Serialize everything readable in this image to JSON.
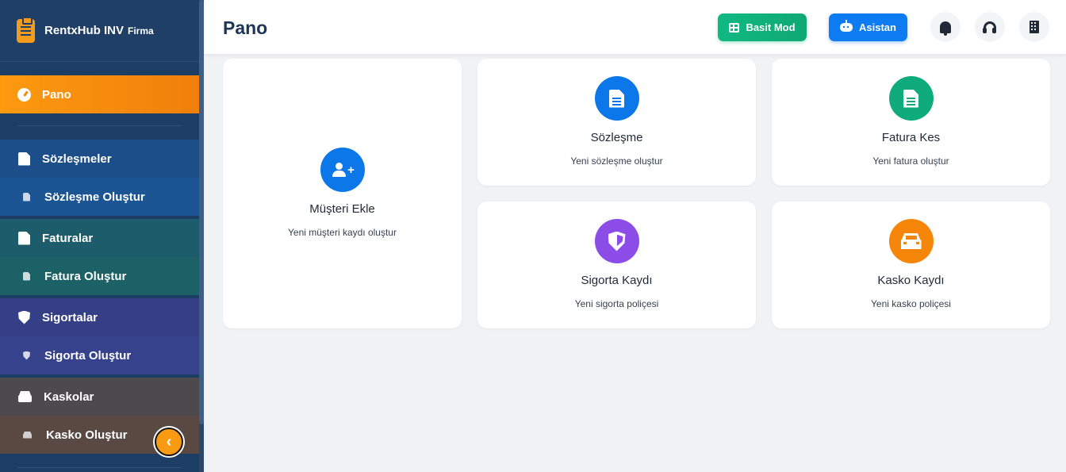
{
  "brand": {
    "name": "RentxHub INV",
    "sub": "Firma"
  },
  "sidebar": {
    "active": {
      "label": "Pano"
    },
    "groups": [
      {
        "label": "Sözleşmeler",
        "sub": "Sözleşme Oluştur"
      },
      {
        "label": "Faturalar",
        "sub": "Fatura Oluştur"
      },
      {
        "label": "Sigortalar",
        "sub": "Sigorta Oluştur"
      },
      {
        "label": "Kaskolar",
        "sub": "Kasko Oluştur"
      }
    ],
    "collapse_glyph": "‹"
  },
  "header": {
    "title": "Pano",
    "basit_label": "Basit Mod",
    "asistan_label": "Asistan"
  },
  "cards": {
    "musteri": {
      "title": "Müşteri Ekle",
      "sub": "Yeni müşteri kaydı oluştur"
    },
    "sozlesme": {
      "title": "Sözleşme",
      "sub": "Yeni sözleşme oluştur"
    },
    "fatura": {
      "title": "Fatura Kes",
      "sub": "Yeni fatura oluştur"
    },
    "sigorta": {
      "title": "Sigorta Kaydı",
      "sub": "Yeni sigorta poliçesi"
    },
    "kasko": {
      "title": "Kasko Kaydı",
      "sub": "Yeni kasko poliçesi"
    }
  },
  "colors": {
    "accent_orange": "#fd9a10",
    "sidebar_bg": "#1c3d64",
    "blue": "#0b77e8",
    "green": "#10ab7c",
    "purple": "#8b4ce8",
    "orange": "#f5860a"
  }
}
